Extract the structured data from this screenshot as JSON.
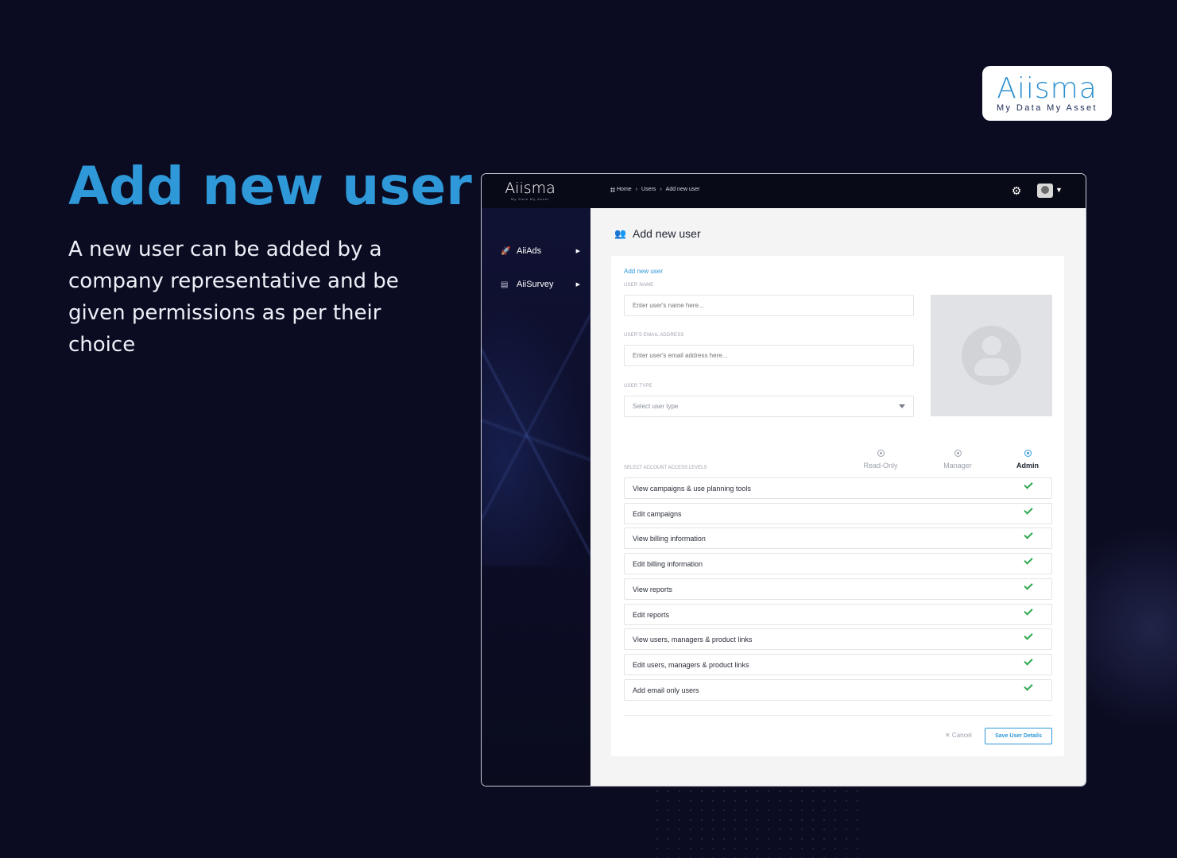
{
  "brand": {
    "logo": "Aiisma",
    "tagline": "My Data My Asset"
  },
  "hero": {
    "title": "Add new user",
    "text": "A new user can be added by a company representative and be given permissions as per their choice"
  },
  "app": {
    "logo": "Aiisma",
    "logo_tagline": "My Data My Asset",
    "breadcrumb": [
      "Home",
      "Users",
      "Add new user"
    ],
    "sidebar": {
      "items": [
        {
          "label": "AiiAds",
          "icon": "rocket-icon"
        },
        {
          "label": "AiiSurvey",
          "icon": "survey-icon"
        }
      ]
    },
    "page_title": "Add new user",
    "form": {
      "section_title": "Add new user",
      "user_name_label": "USER NAME",
      "user_name_placeholder": "Enter user's name here...",
      "email_label": "USER'S EMAIL ADDRESS",
      "email_placeholder": "Enter user's email address here...",
      "user_type_label": "USER TYPE",
      "user_type_value": "Select user type",
      "access_label": "SELECT ACCOUNT ACCESS LEVELS",
      "levels": [
        {
          "label": "Read-Only",
          "selected": false
        },
        {
          "label": "Manager",
          "selected": false
        },
        {
          "label": "Admin",
          "selected": true
        }
      ],
      "permissions": [
        "View campaigns & use planning tools",
        "Edit campaigns",
        "View billing information",
        "Edit billing information",
        "View reports",
        "Edit reports",
        "View users, managers & product links",
        "Edit users, managers & product links",
        "Add email only users"
      ],
      "cancel_label": "✕ Cancel",
      "save_label": "Save User Details"
    }
  },
  "colors": {
    "accent": "#2e98d8",
    "background": "#0b0c22",
    "check": "#2fa84f"
  }
}
